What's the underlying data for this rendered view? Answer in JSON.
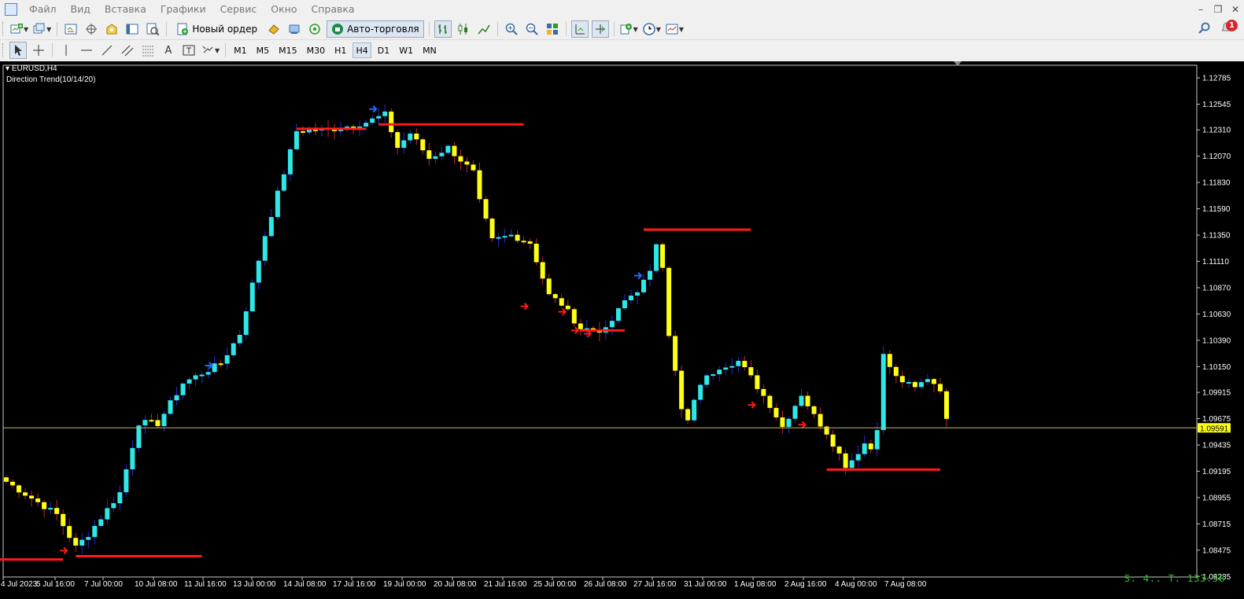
{
  "menu": {
    "items": [
      "Файл",
      "Вид",
      "Вставка",
      "Графики",
      "Сервис",
      "Окно",
      "Справка"
    ],
    "window_controls": [
      "–",
      "❐",
      "✕"
    ]
  },
  "toolbar": {
    "new_order_label": "Новый ордер",
    "autotrading_label": "Авто-торговля",
    "notifications_count": "1",
    "icons": [
      "new-chart-icon",
      "profiles-icon",
      "market-watch-icon",
      "navigator-crosshair-icon",
      "data-window-icon",
      "terminal-icon",
      "strategy-tester-icon",
      "new-order-icon",
      "metaeditor-icon",
      "signals-icon",
      "autotrading-icon",
      "bar-chart-icon",
      "candlestick-icon",
      "line-chart-icon",
      "zoom-in-icon",
      "zoom-out-icon",
      "tile-windows-icon",
      "chart-shift-icon",
      "autoscroll-icon",
      "indicators-icon",
      "periods-icon",
      "templates-icon",
      "search-icon",
      "notifications-icon"
    ]
  },
  "draw_tools": {
    "timeframes": [
      "M1",
      "M5",
      "M15",
      "M30",
      "H1",
      "H4",
      "D1",
      "W1",
      "MN"
    ],
    "active_timeframe": "H4",
    "text_tool_label": "A"
  },
  "chart": {
    "symbol_label": "EURUSD,H4",
    "indicator_label": "Direction Trend(10/14/20)",
    "current_price_label": "1.09591",
    "status_text": "S: 4.. T: 133:58",
    "colors": {
      "background": "#000000",
      "bull": "#2ee8e8",
      "bear": "#ffff14",
      "wick_bull": "#2b2bd9",
      "wick_bear": "#c0282a",
      "level": "#ff1a1a",
      "price_line": "#c8b864",
      "axis_text": "#ffffff",
      "status": "#21c521"
    }
  },
  "chart_data": {
    "type": "candlestick",
    "symbol": "EURUSD",
    "timeframe": "H4",
    "y_ticks": [
      "1.12785",
      "1.12545",
      "1.12310",
      "1.12070",
      "1.11830",
      "1.11590",
      "1.11350",
      "1.11110",
      "1.10870",
      "1.10630",
      "1.10390",
      "1.10150",
      "1.09915",
      "1.09675",
      "1.09435",
      "1.09195",
      "1.08955",
      "1.08715",
      "1.08475",
      "1.08235"
    ],
    "x_ticks": [
      "4 Jul 2023",
      "5 Jul 16:00",
      "7 Jul 00:00",
      "10 Jul 08:00",
      "11 Jul 16:00",
      "13 Jul 00:00",
      "14 Jul 08:00",
      "17 Jul 16:00",
      "19 Jul 00:00",
      "20 Jul 08:00",
      "21 Jul 16:00",
      "25 Jul 00:00",
      "26 Jul 08:00",
      "27 Jul 16:00",
      "31 Jul 00:00",
      "1 Aug 08:00",
      "2 Aug 16:00",
      "4 Aug 00:00",
      "7 Aug 08:00"
    ],
    "ylim": [
      1.0823,
      1.129
    ],
    "current_price": 1.09591,
    "anchors": [
      [
        0,
        1.091
      ],
      [
        8,
        1.088
      ],
      [
        11,
        1.085
      ],
      [
        13,
        1.0862
      ],
      [
        18,
        1.09
      ],
      [
        21,
        1.0964
      ],
      [
        24,
        1.0963
      ],
      [
        28,
        1.1
      ],
      [
        34,
        1.1018
      ],
      [
        37,
        1.1045
      ],
      [
        41,
        1.1135
      ],
      [
        46,
        1.123
      ],
      [
        52,
        1.1232
      ],
      [
        57,
        1.1238
      ],
      [
        60,
        1.1245
      ],
      [
        62,
        1.1215
      ],
      [
        64,
        1.1228
      ],
      [
        67,
        1.1205
      ],
      [
        70,
        1.1215
      ],
      [
        74,
        1.1192
      ],
      [
        75,
        1.1165
      ],
      [
        77,
        1.113
      ],
      [
        80,
        1.1135
      ],
      [
        83,
        1.1128
      ],
      [
        86,
        1.108
      ],
      [
        88,
        1.1072
      ],
      [
        91,
        1.105
      ],
      [
        95,
        1.1048
      ],
      [
        98,
        1.1075
      ],
      [
        100,
        1.1085
      ],
      [
        102,
        1.11
      ],
      [
        103,
        1.1128
      ],
      [
        104,
        1.1108
      ],
      [
        105,
        1.1045
      ],
      [
        107,
        1.0975
      ],
      [
        108,
        1.0965
      ],
      [
        110,
        1.1
      ],
      [
        113,
        1.1015
      ],
      [
        116,
        1.102
      ],
      [
        118,
        1.1005
      ],
      [
        121,
        1.098
      ],
      [
        123,
        1.096
      ],
      [
        126,
        1.099
      ],
      [
        128,
        1.097
      ],
      [
        130,
        1.0955
      ],
      [
        133,
        1.0925
      ],
      [
        134,
        1.093
      ],
      [
        136,
        1.0945
      ],
      [
        137,
        1.094
      ],
      [
        138,
        1.096
      ],
      [
        139,
        1.1025
      ],
      [
        141,
        1.1005
      ],
      [
        144,
        1.0995
      ],
      [
        146,
        1.1005
      ],
      [
        148,
        1.0995
      ],
      [
        149,
        1.0965
      ]
    ],
    "levels": [
      {
        "from_bar": -1,
        "to_bar": 9,
        "price": 1.0839
      },
      {
        "from_bar": 11,
        "to_bar": 31,
        "price": 1.0842
      },
      {
        "from_bar": 46,
        "to_bar": 57,
        "price": 1.1232
      },
      {
        "from_bar": 59,
        "to_bar": 82,
        "price": 1.1236
      },
      {
        "from_bar": 101,
        "to_bar": 118,
        "price": 1.114
      },
      {
        "from_bar": 91,
        "to_bar": 98,
        "price": 1.1048
      },
      {
        "from_bar": 130,
        "to_bar": 148,
        "price": 1.0921
      }
    ],
    "arrows": [
      {
        "bar": 9,
        "price": 1.0847,
        "dir": "bear"
      },
      {
        "bar": 32,
        "price": 1.1016,
        "dir": "bull"
      },
      {
        "bar": 58,
        "price": 1.125,
        "dir": "bull"
      },
      {
        "bar": 82,
        "price": 1.107,
        "dir": "bear"
      },
      {
        "bar": 88,
        "price": 1.1065,
        "dir": "bear"
      },
      {
        "bar": 90,
        "price": 1.1048,
        "dir": "bear"
      },
      {
        "bar": 92,
        "price": 1.1045,
        "dir": "bear"
      },
      {
        "bar": 100,
        "price": 1.1098,
        "dir": "bull"
      },
      {
        "bar": 118,
        "price": 1.098,
        "dir": "bear"
      },
      {
        "bar": 126,
        "price": 1.0962,
        "dir": "bear"
      }
    ]
  }
}
